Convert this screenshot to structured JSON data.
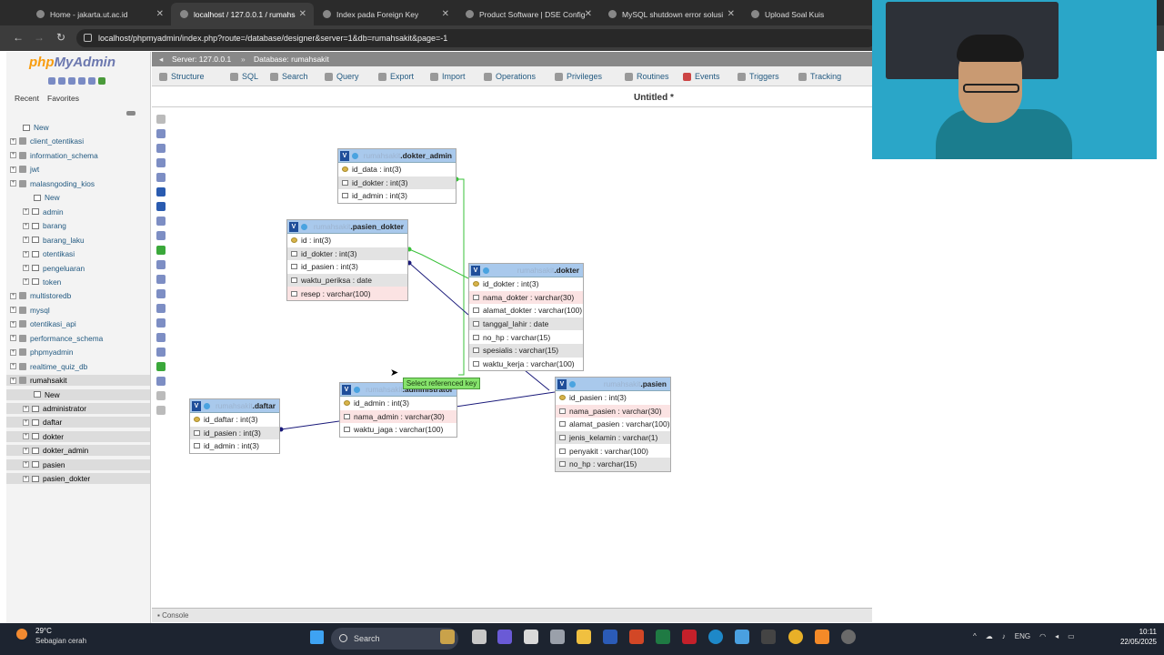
{
  "browser": {
    "tabs": [
      {
        "title": "Home - jakarta.ut.ac.id",
        "active": false
      },
      {
        "title": "localhost / 127.0.0.1 / rumahsa",
        "active": true
      },
      {
        "title": "Index pada Foreign Key",
        "active": false
      },
      {
        "title": "Product Software | DSE Config",
        "active": false
      },
      {
        "title": "MySQL shutdown error solusi",
        "active": false
      },
      {
        "title": "Upload Soal Kuis",
        "active": false
      }
    ],
    "url": "localhost/phpmyadmin/index.php?route=/database/designer&server=1&db=rumahsakit&page=-1"
  },
  "sidebar": {
    "logo_php": "php",
    "logo_myadmin": "MyAdmin",
    "recent": "Recent",
    "favorites": "Favorites",
    "tree": [
      {
        "label": "New",
        "level": 1,
        "kind": "new"
      },
      {
        "label": "client_otentikasi",
        "level": 0,
        "kind": "db"
      },
      {
        "label": "information_schema",
        "level": 0,
        "kind": "db"
      },
      {
        "label": "jwt",
        "level": 0,
        "kind": "db"
      },
      {
        "label": "malasngoding_kios",
        "level": 0,
        "kind": "db"
      },
      {
        "label": "New",
        "level": 2,
        "kind": "new"
      },
      {
        "label": "admin",
        "level": 1,
        "kind": "table"
      },
      {
        "label": "barang",
        "level": 1,
        "kind": "table"
      },
      {
        "label": "barang_laku",
        "level": 1,
        "kind": "table"
      },
      {
        "label": "otentikasi",
        "level": 1,
        "kind": "table"
      },
      {
        "label": "pengeluaran",
        "level": 1,
        "kind": "table"
      },
      {
        "label": "token",
        "level": 1,
        "kind": "table"
      },
      {
        "label": "multistoredb",
        "level": 0,
        "kind": "db"
      },
      {
        "label": "mysql",
        "level": 0,
        "kind": "db"
      },
      {
        "label": "otentikasi_api",
        "level": 0,
        "kind": "db"
      },
      {
        "label": "performance_schema",
        "level": 0,
        "kind": "db"
      },
      {
        "label": "phpmyadmin",
        "level": 0,
        "kind": "db"
      },
      {
        "label": "realtime_quiz_db",
        "level": 0,
        "kind": "db"
      },
      {
        "label": "rumahsakit",
        "level": 0,
        "kind": "db",
        "selected": true
      },
      {
        "label": "New",
        "level": 2,
        "kind": "new",
        "selected": true
      },
      {
        "label": "administrator",
        "level": 1,
        "kind": "table",
        "selected": true
      },
      {
        "label": "daftar",
        "level": 1,
        "kind": "table",
        "selected": true
      },
      {
        "label": "dokter",
        "level": 1,
        "kind": "table",
        "selected": true
      },
      {
        "label": "dokter_admin",
        "level": 1,
        "kind": "table",
        "selected": true
      },
      {
        "label": "pasien",
        "level": 1,
        "kind": "table",
        "selected": true
      },
      {
        "label": "pasien_dokter",
        "level": 1,
        "kind": "table",
        "selected": true
      }
    ]
  },
  "topbar": {
    "server": "Server: 127.0.0.1",
    "database": "Database: rumahsakit"
  },
  "menu": [
    "Structure",
    "SQL",
    "Search",
    "Query",
    "Export",
    "Import",
    "Operations",
    "Privileges",
    "Routines",
    "Events",
    "Triggers",
    "Tracking"
  ],
  "designer": {
    "title": "Untitled *",
    "tooltip": "Select referenced key",
    "console": "Console",
    "tables": [
      {
        "id": "dokter_admin",
        "schema": "rumahsakit",
        "name": "dokter_admin",
        "rows": [
          {
            "text": "id_data : int(3)",
            "style": "",
            "pk": true
          },
          {
            "text": "id_dokter : int(3)",
            "style": "g",
            "pk": false
          },
          {
            "text": "id_admin : int(3)",
            "style": "",
            "pk": false
          }
        ]
      },
      {
        "id": "pasien_dokter",
        "schema": "rumahsakit",
        "name": "pasien_dokter",
        "rows": [
          {
            "text": "id : int(3)",
            "style": "",
            "pk": true
          },
          {
            "text": "id_dokter : int(3)",
            "style": "g",
            "pk": false
          },
          {
            "text": "id_pasien : int(3)",
            "style": "",
            "pk": false
          },
          {
            "text": "waktu_periksa : date",
            "style": "g",
            "pk": false
          },
          {
            "text": "resep : varchar(100)",
            "style": "p",
            "pk": false
          }
        ]
      },
      {
        "id": "dokter",
        "schema": "rumahsakit",
        "name": "dokter",
        "rows": [
          {
            "text": "id_dokter : int(3)",
            "style": "",
            "pk": true
          },
          {
            "text": "nama_dokter : varchar(30)",
            "style": "p",
            "pk": false
          },
          {
            "text": "alamat_dokter : varchar(100)",
            "style": "",
            "pk": false
          },
          {
            "text": "tanggal_lahir : date",
            "style": "g",
            "pk": false
          },
          {
            "text": "no_hp : varchar(15)",
            "style": "",
            "pk": false
          },
          {
            "text": "spesialis : varchar(15)",
            "style": "g",
            "pk": false
          },
          {
            "text": "waktu_kerja : varchar(100)",
            "style": "",
            "pk": false
          }
        ]
      },
      {
        "id": "administrator",
        "schema": "rumahsakit",
        "name": "administrator",
        "rows": [
          {
            "text": "id_admin : int(3)",
            "style": "",
            "pk": true
          },
          {
            "text": "nama_admin : varchar(30)",
            "style": "p",
            "pk": false
          },
          {
            "text": "waktu_jaga : varchar(100)",
            "style": "",
            "pk": false
          }
        ]
      },
      {
        "id": "pasien",
        "schema": "rumahsakit",
        "name": "pasien",
        "rows": [
          {
            "text": "id_pasien : int(3)",
            "style": "",
            "pk": true
          },
          {
            "text": "nama_pasien : varchar(30)",
            "style": "p",
            "pk": false
          },
          {
            "text": "alamat_pasien : varchar(100)",
            "style": "",
            "pk": false
          },
          {
            "text": "jenis_kelamin : varchar(1)",
            "style": "g",
            "pk": false
          },
          {
            "text": "penyakit : varchar(100)",
            "style": "",
            "pk": false
          },
          {
            "text": "no_hp : varchar(15)",
            "style": "g",
            "pk": false
          }
        ]
      },
      {
        "id": "daftar",
        "schema": "rumahsakit",
        "name": "daftar",
        "rows": [
          {
            "text": "id_daftar : int(3)",
            "style": "",
            "pk": true
          },
          {
            "text": "id_pasien : int(3)",
            "style": "g",
            "pk": false
          },
          {
            "text": "id_admin : int(3)",
            "style": "",
            "pk": false
          }
        ]
      }
    ]
  },
  "taskbar": {
    "temperature": "29°C",
    "weather": "Sebagian cerah",
    "search": "Search",
    "lang": "ENG",
    "time": "10:11",
    "date": "22/05/2025"
  }
}
